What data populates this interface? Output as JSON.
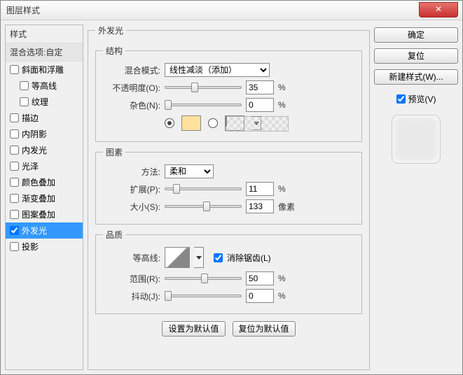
{
  "title": "图层样式",
  "sidebar": {
    "header": "样式",
    "subheader": "混合选项:自定",
    "items": [
      {
        "label": "斜面和浮雕",
        "checked": false,
        "indent": false
      },
      {
        "label": "等高线",
        "checked": false,
        "indent": true
      },
      {
        "label": "纹理",
        "checked": false,
        "indent": true
      },
      {
        "label": "描边",
        "checked": false,
        "indent": false
      },
      {
        "label": "内阴影",
        "checked": false,
        "indent": false
      },
      {
        "label": "内发光",
        "checked": false,
        "indent": false
      },
      {
        "label": "光泽",
        "checked": false,
        "indent": false
      },
      {
        "label": "颜色叠加",
        "checked": false,
        "indent": false
      },
      {
        "label": "渐变叠加",
        "checked": false,
        "indent": false
      },
      {
        "label": "图案叠加",
        "checked": false,
        "indent": false
      },
      {
        "label": "外发光",
        "checked": true,
        "indent": false,
        "active": true
      },
      {
        "label": "投影",
        "checked": false,
        "indent": false
      }
    ]
  },
  "main": {
    "title": "外发光",
    "structure": {
      "title": "结构",
      "blend_label": "混合模式:",
      "blend_value": "线性减淡（添加）",
      "opacity_label": "不透明度(O):",
      "opacity_value": "35",
      "opacity_unit": "%",
      "noise_label": "杂色(N):",
      "noise_value": "0",
      "noise_unit": "%"
    },
    "element": {
      "title": "图素",
      "method_label": "方法:",
      "method_value": "柔和",
      "spread_label": "扩展(P):",
      "spread_value": "11",
      "spread_unit": "%",
      "size_label": "大小(S):",
      "size_value": "133",
      "size_unit": "像素"
    },
    "quality": {
      "title": "品质",
      "contour_label": "等高线:",
      "antialias_label": "消除锯齿(L)",
      "range_label": "范围(R):",
      "range_value": "50",
      "range_unit": "%",
      "jitter_label": "抖动(J):",
      "jitter_value": "0",
      "jitter_unit": "%"
    },
    "set_default": "设置为默认值",
    "reset_default": "复位为默认值"
  },
  "right": {
    "ok": "确定",
    "cancel": "复位",
    "new_style": "新建样式(W)...",
    "preview": "预览(V)"
  }
}
